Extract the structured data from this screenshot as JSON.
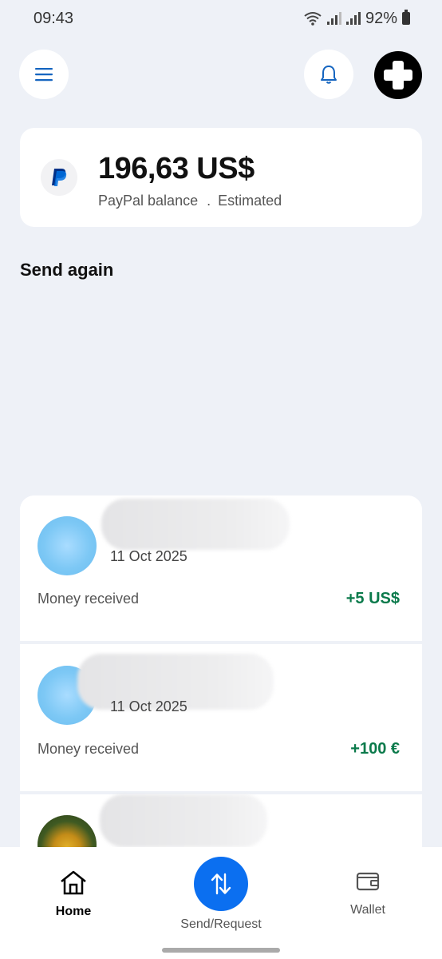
{
  "status_bar": {
    "time": "09:43",
    "battery": "92%",
    "icons": [
      "wifi-icon",
      "signal-icon",
      "battery-icon"
    ]
  },
  "header": {
    "icons": [
      "menu-icon",
      "bell-icon",
      "add-icon"
    ]
  },
  "balance": {
    "amount": "196,63 US$",
    "label": "PayPal balance",
    "separator": ".",
    "estimated": "Estimated",
    "icon": "paypal-logo-icon"
  },
  "send_again": {
    "title": "Send again"
  },
  "activity": [
    {
      "date": "11 Oct 2025",
      "type": "Money received",
      "amount": "+5 US$"
    },
    {
      "date": "11 Oct 2025",
      "type": "Money received",
      "amount": "+100 €"
    }
  ],
  "bottom_nav": {
    "home": "Home",
    "send_request": "Send/Request",
    "wallet": "Wallet",
    "icons": [
      "home-icon",
      "swap-arrows-icon",
      "wallet-icon"
    ]
  },
  "colors": {
    "background": "#eef1f7",
    "primary_blue": "#0b6ff0",
    "positive_green": "#0b7a4b"
  }
}
